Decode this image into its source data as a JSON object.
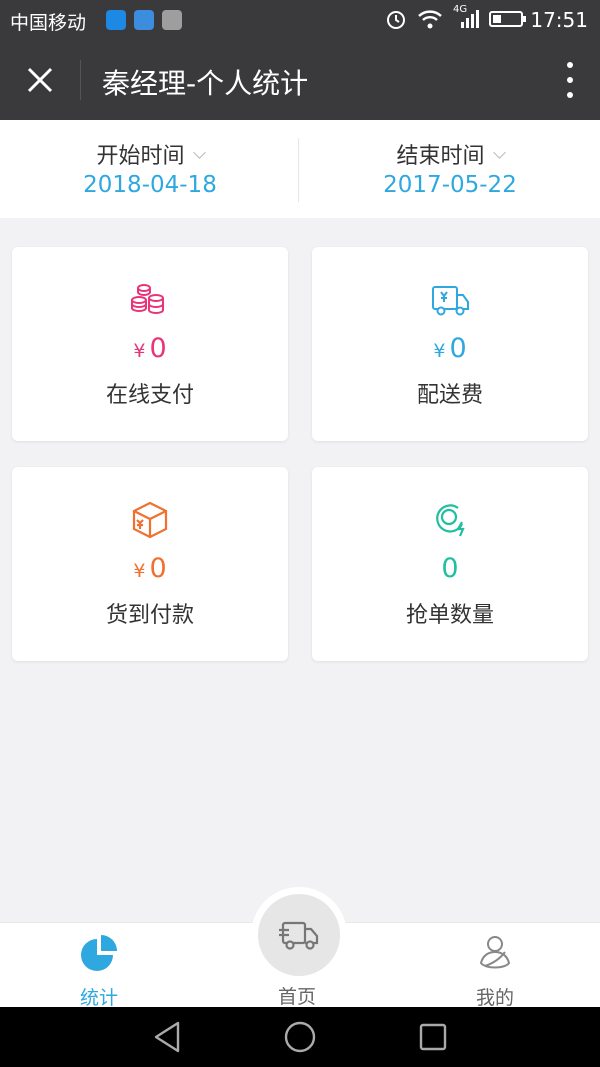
{
  "status_bar": {
    "carrier": "中国移动",
    "time": "17:51",
    "network": "4G"
  },
  "header": {
    "title": "秦经理-个人统计"
  },
  "dates": {
    "start_label": "开始时间",
    "start_value": "2018-04-18",
    "end_label": "结束时间",
    "end_value": "2017-05-22"
  },
  "cards": [
    {
      "icon": "coins-icon",
      "currency": "¥",
      "value": "0",
      "label": "在线支付",
      "color": "#e8357a"
    },
    {
      "icon": "delivery-truck-icon",
      "currency": "¥",
      "value": "0",
      "label": "配送费",
      "color": "#2fa8e0"
    },
    {
      "icon": "package-box-icon",
      "currency": "¥",
      "value": "0",
      "label": "货到付款",
      "color": "#f07030"
    },
    {
      "icon": "grab-order-icon",
      "currency": "",
      "value": "0",
      "label": "抢单数量",
      "color": "#20bfa0"
    }
  ],
  "tabs": [
    {
      "icon": "pie-chart-icon",
      "label": "统计",
      "active": true
    },
    {
      "icon": "truck-icon",
      "label": "首页",
      "active": false
    },
    {
      "icon": "person-icon",
      "label": "我的",
      "active": false
    }
  ],
  "colors": {
    "accent": "#2fa8e0",
    "header_bg": "#3a3a3c",
    "page_bg": "#f2f2f4"
  }
}
